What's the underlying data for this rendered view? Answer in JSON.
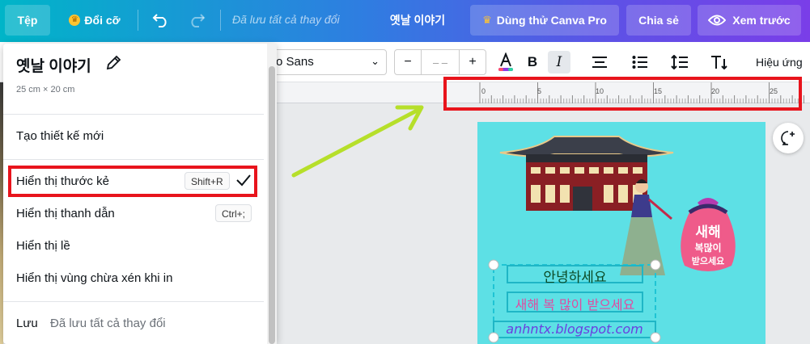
{
  "topbar": {
    "file": "Tệp",
    "resize": "Đổi cỡ",
    "status": "Đã lưu tất cả thay đổi",
    "doc_title": "옛날 이야기",
    "try_pro": "Dùng thử Canva Pro",
    "share": "Chia sẻ",
    "preview": "Xem trước"
  },
  "format": {
    "font": "o Sans",
    "size_value": "– –",
    "minus": "−",
    "plus": "+",
    "bold": "B",
    "italic": "I",
    "effects": "Hiệu ứng"
  },
  "menu": {
    "title": "옛날 이야기",
    "dimensions": "25 cm × 20 cm",
    "items": [
      {
        "label": "Tạo thiết kế mới"
      },
      {
        "label": "Hiển thị thước kẻ",
        "shortcut": "Shift+R"
      },
      {
        "label": "Hiển thị thanh dẫn",
        "shortcut": "Ctrl+;"
      },
      {
        "label": "Hiển thị lề"
      },
      {
        "label": "Hiển thị vùng chừa xén khi in"
      }
    ],
    "save": {
      "label": "Lưu",
      "status": "Đã lưu tất cả thay đổi"
    }
  },
  "ruler": {
    "labels": [
      "0",
      "5",
      "10",
      "15",
      "20",
      "25"
    ]
  },
  "design": {
    "line1": "안녕하세요",
    "line2": "새해 복 많이 받으세요",
    "line3": "anhntx.blogspot.com",
    "bag_text1": "새해",
    "bag_text2": "복많이",
    "bag_text3": "받으세요"
  },
  "colors": {
    "highlight": "#e8141c",
    "arrow": "#b6df2a",
    "canvas_bg": "#5de0e5"
  }
}
